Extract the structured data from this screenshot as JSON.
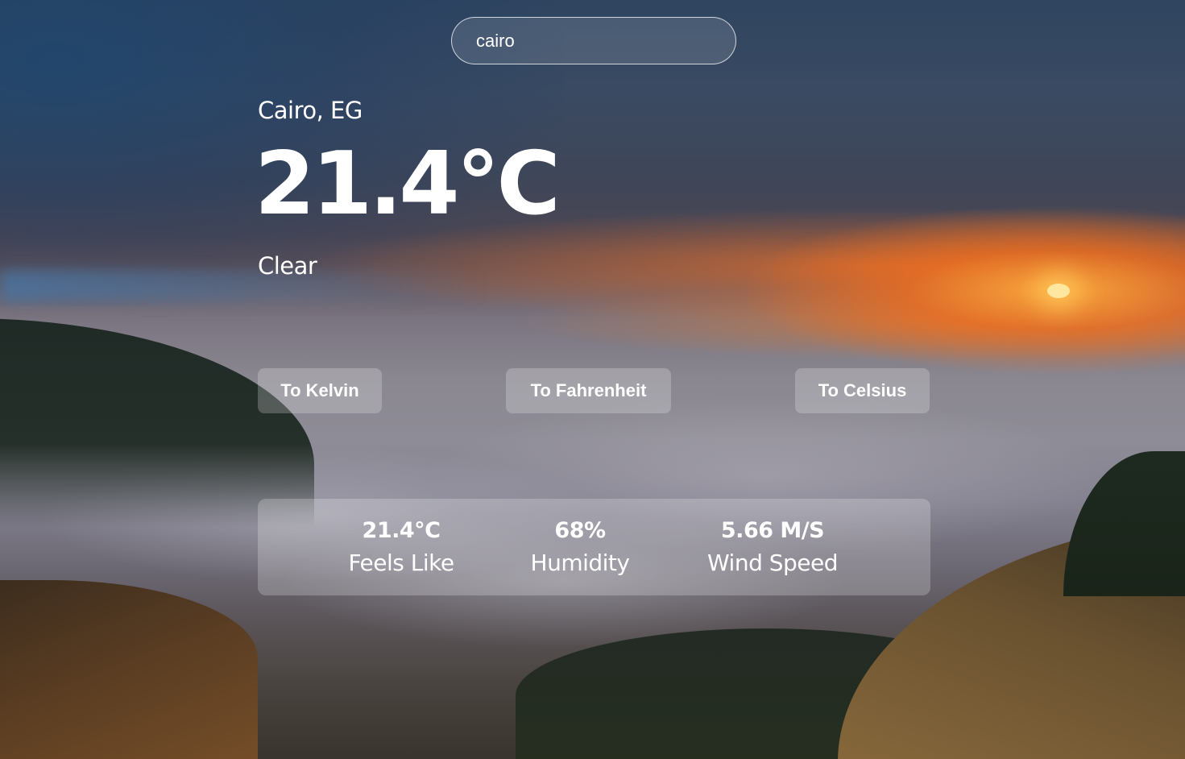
{
  "search": {
    "value": "cairo"
  },
  "weather": {
    "location": "Cairo, EG",
    "temperature": "21.4°C",
    "condition": "Clear"
  },
  "buttons": {
    "kelvin": "To Kelvin",
    "fahrenheit": "To Fahrenheit",
    "celsius": "To Celsius"
  },
  "details": {
    "feels_like": {
      "value": "21.4°C",
      "label": "Feels Like"
    },
    "humidity": {
      "value": "68%",
      "label": "Humidity"
    },
    "wind_speed": {
      "value": "5.66 M/S",
      "label": "Wind Speed"
    }
  }
}
